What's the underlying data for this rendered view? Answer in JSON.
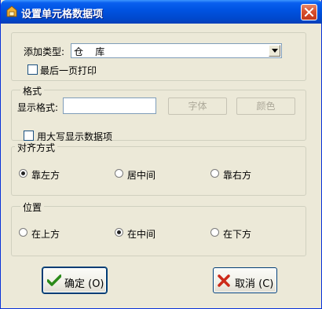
{
  "window": {
    "title": "设置单元格数据项",
    "close_icon": "close-icon"
  },
  "type_row": {
    "label": "添加类型:",
    "value": "仓    库"
  },
  "last_page_print": {
    "label": "最后一页打印",
    "checked": false
  },
  "format_group": {
    "title": "格式",
    "display_label": "显示格式:",
    "display_value": "",
    "font_button": "字体",
    "color_button": "颜色",
    "uppercase_label": "用大写显示数据项",
    "uppercase_checked": false
  },
  "align_group": {
    "title": "对齐方式",
    "options": [
      {
        "label": "靠左方",
        "checked": true
      },
      {
        "label": "居中间",
        "checked": false
      },
      {
        "label": "靠右方",
        "checked": false
      }
    ]
  },
  "position_group": {
    "title": "位置",
    "options": [
      {
        "label": "在上方",
        "checked": false
      },
      {
        "label": "在中间",
        "checked": true
      },
      {
        "label": "在下方",
        "checked": false
      }
    ]
  },
  "buttons": {
    "ok": "确定 (O)",
    "cancel": "取消 (C)"
  },
  "colors": {
    "title_bar": "#0054e3",
    "ok_icon": "#2a8a1a",
    "cancel_icon": "#cc2a1a"
  }
}
